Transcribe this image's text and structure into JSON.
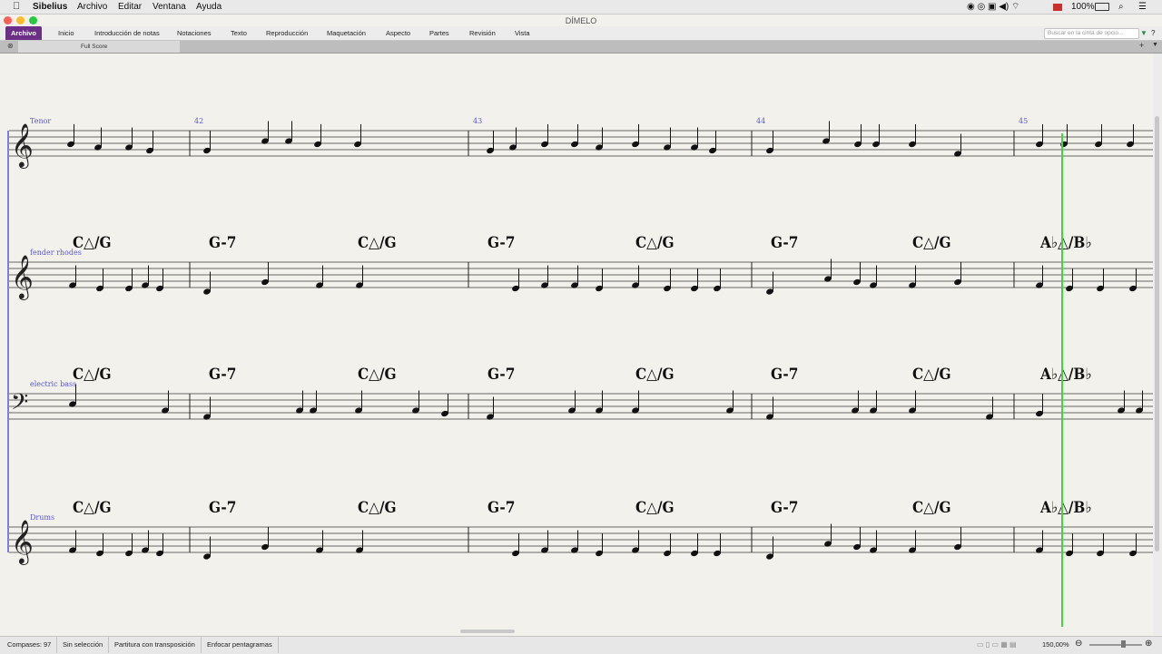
{
  "menubar": {
    "app_name": "Sibelius",
    "items": [
      "Archivo",
      "Editar",
      "Ventana",
      "Ayuda"
    ],
    "battery": "100%"
  },
  "window": {
    "title": "DÍMELO"
  },
  "ribbon": {
    "tabs": [
      "Archivo",
      "Inicio",
      "Introducción de notas",
      "Notaciones",
      "Texto",
      "Reproducción",
      "Maquetación",
      "Aspecto",
      "Partes",
      "Revisión",
      "Vista"
    ],
    "search_placeholder": "Buscar en la cinta de opcio..."
  },
  "score_tab": {
    "label": "Full Score"
  },
  "score": {
    "bar_numbers": [
      "42",
      "43",
      "44",
      "45"
    ],
    "instruments": [
      "Tenor",
      "fender rhodes",
      "electric bass",
      "Drums"
    ],
    "chords": [
      "C△/G",
      "G-7",
      "C△/G",
      "G-7",
      "C△/G",
      "G-7",
      "C△/G",
      "A♭△/B♭"
    ],
    "playback_color": "#3fd63f",
    "instrument_label_color": "#5a5ad0"
  },
  "statusbar": {
    "measures": "Compases: 97",
    "selection": "Sin selección",
    "transposition": "Partitura con transposición",
    "focus": "Enfocar pentagramas",
    "zoom": "150,00%"
  }
}
